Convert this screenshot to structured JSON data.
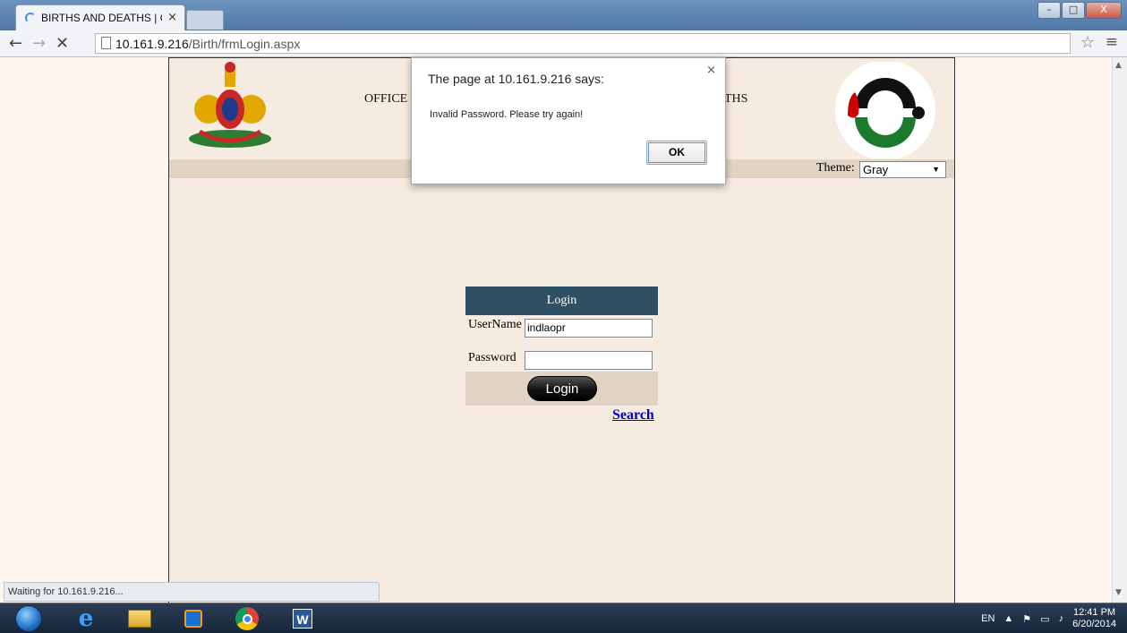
{
  "browser": {
    "tab_title": "BIRTHS AND DEATHS | OF",
    "tab_close": "×",
    "url_host": "10.161.9.216",
    "url_path": "/Birth/frmLogin.aspx",
    "status_text": "Waiting for 10.161.9.216..."
  },
  "window_controls": {
    "minimize": "–",
    "maximize": "□",
    "close": "X"
  },
  "header": {
    "office_text_left": "OFFICE",
    "office_text_right": "THS"
  },
  "theme": {
    "label": "Theme:",
    "selected": "Gray"
  },
  "login": {
    "title": "Login",
    "username_label": "UserName",
    "username_value": "indlaopr",
    "password_label": "Password",
    "password_value": "",
    "button_label": "Login",
    "search_link": "Search"
  },
  "dialog": {
    "title": "The page at 10.161.9.216 says:",
    "message": "Invalid Password. Please try again!",
    "ok_label": "OK",
    "close_glyph": "×"
  },
  "taskbar": {
    "language": "EN",
    "time": "12:41 PM",
    "date": "6/20/2014"
  },
  "colors": {
    "login_header_bg": "#2f4f63",
    "page_bg": "#fdf5ee",
    "content_bg": "#f6ebe0",
    "theme_bar_bg": "#e2d4c4",
    "link": "#0000cc"
  }
}
